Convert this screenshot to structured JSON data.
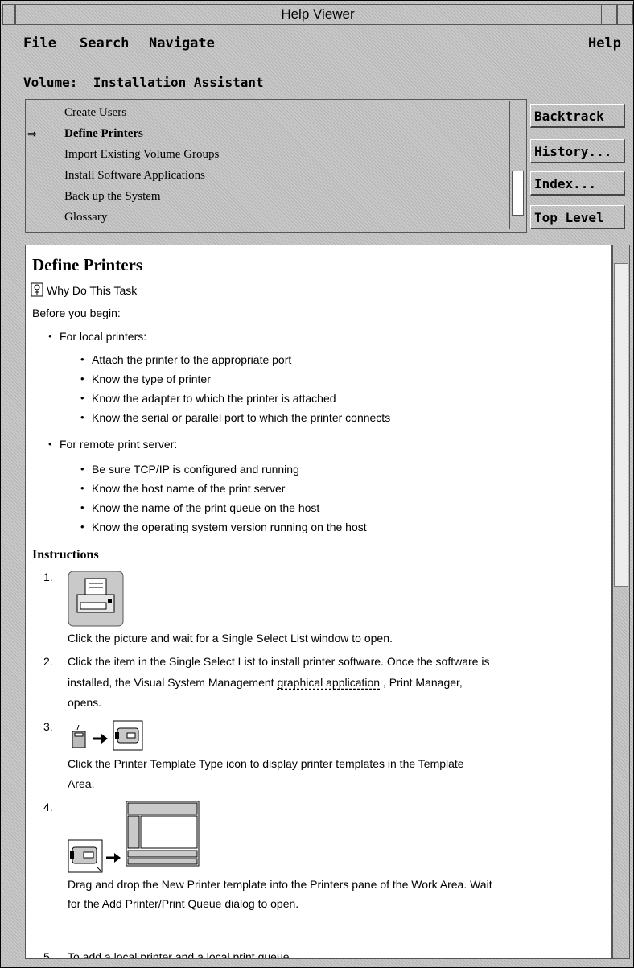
{
  "window": {
    "title": "Help Viewer"
  },
  "menubar": {
    "file": "File",
    "search": "Search",
    "navigate": "Navigate",
    "help": "Help"
  },
  "volume": {
    "label": "Volume:  Installation Assistant"
  },
  "topics": {
    "selected_marker": "⇒",
    "items": [
      "Create Users",
      "Define Printers",
      "Import Existing Volume Groups",
      "Install Software Applications",
      "Back up the System",
      "Glossary"
    ]
  },
  "buttons": {
    "backtrack": "Backtrack",
    "history": "History...",
    "index": "Index...",
    "top_level": "Top Level"
  },
  "content": {
    "title": "Define Printers",
    "why": "Why Do This Task",
    "before": "Before you begin:",
    "local": {
      "heading": "For local printers:",
      "items": [
        "Attach the printer to the appropriate port",
        "Know the type of printer",
        "Know the adapter to which the printer is attached",
        "Know the serial or parallel port to which the printer connects"
      ]
    },
    "remote": {
      "heading": "For remote print server:",
      "items": [
        "Be sure TCP/IP is configured and running",
        "Know the host name of the print server",
        "Know the name of the print queue on the host",
        "Know the operating system version running on the host"
      ]
    },
    "instructions": {
      "heading": "Instructions",
      "step1": {
        "num": "1.",
        "text": "Click the picture and wait for a Single Select List window to open."
      },
      "step2": {
        "num": "2.",
        "line1": "Click the item in the Single Select List to install printer software. Once the software is",
        "line2_pre": "installed, the Visual System Management ",
        "line2_link": "graphical application",
        "line2_post": " , Print Manager,",
        "line3": "opens."
      },
      "step3": {
        "num": "3.",
        "line1": "Click the Printer Template Type icon to display printer templates in the Template",
        "line2": "Area."
      },
      "step4": {
        "num": "4.",
        "line1": "Drag and drop the New Printer template into the Printers pane of the Work Area. Wait",
        "line2": "for the Add Printer/Print Queue dialog to open."
      },
      "step5": {
        "num": "5.",
        "text": "To add a local printer and a local print queue"
      }
    }
  }
}
